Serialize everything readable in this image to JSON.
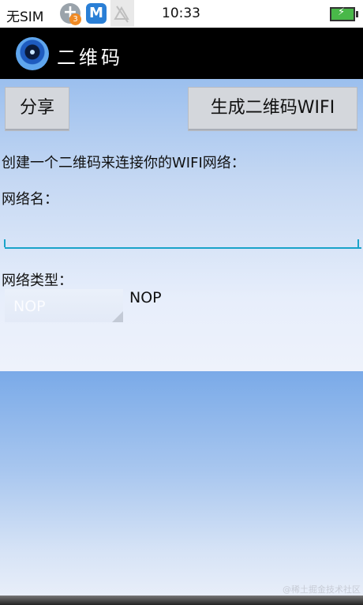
{
  "status": {
    "sim": "无SIM",
    "badge_count": "3",
    "m_icon": "M",
    "time": "10:33",
    "icons": [
      "add-circle-icon",
      "m-app-icon",
      "no-signal-icon",
      "battery-charging-icon"
    ]
  },
  "appbar": {
    "title": "二维码"
  },
  "buttons": {
    "share": "分享",
    "generate": "生成二维码WIFI"
  },
  "form": {
    "intro": "创建一个二维码来连接你的WIFI网络：",
    "name_label": "网络名：",
    "name_value": "",
    "type_label": "网络类型：",
    "type_spinner_value": "NOP",
    "type_selected_text": "NOP"
  },
  "watermark": "@稀土掘金技术社区",
  "colors": {
    "accent": "#1aa3c9",
    "titlebar": "#000000"
  }
}
